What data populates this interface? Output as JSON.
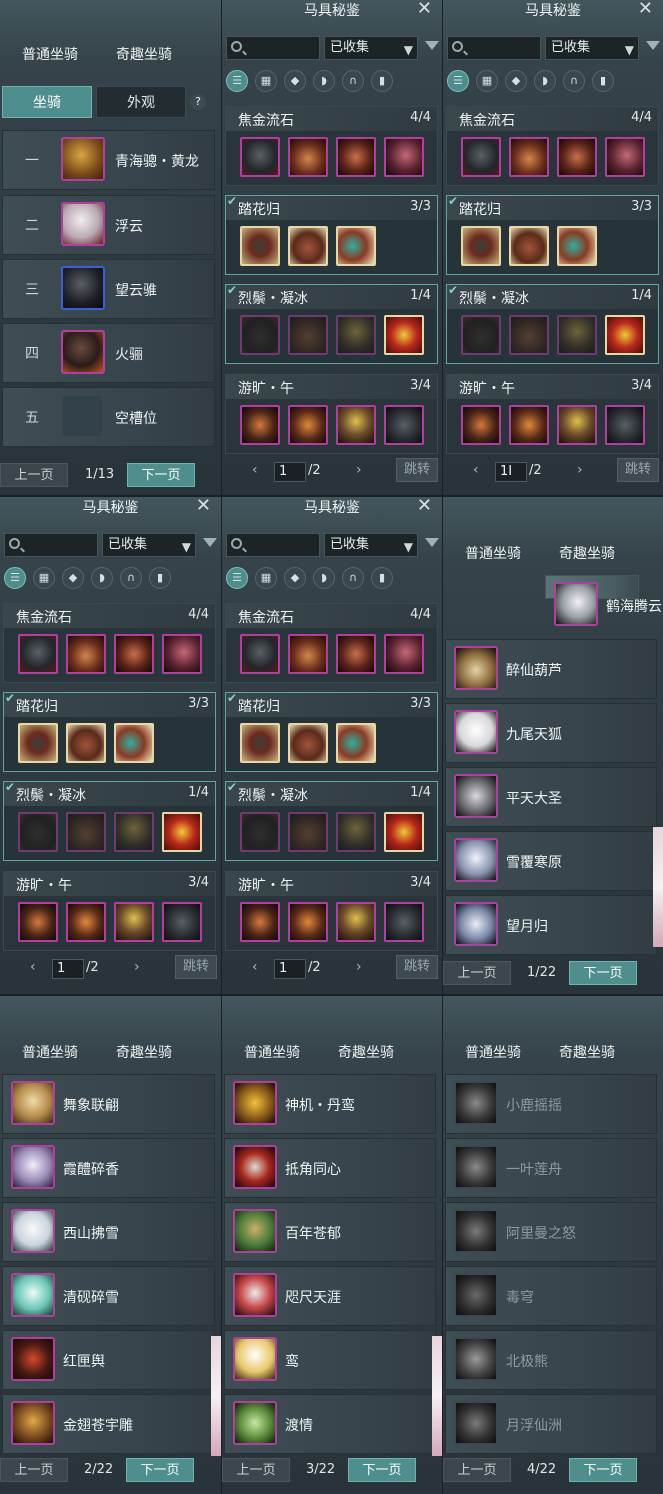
{
  "mount_tabs": {
    "normal": "普通坐骑",
    "fun": "奇趣坐骑"
  },
  "sub_tabs": {
    "mount": "坐骑",
    "appearance": "外观",
    "help": "?"
  },
  "pager": {
    "prev": "上一页",
    "next": "下一页"
  },
  "panel1": {
    "rows": [
      {
        "num": "一",
        "name": "青海骢・黄龙"
      },
      {
        "num": "二",
        "name": "浮云"
      },
      {
        "num": "三",
        "name": "望云骓"
      },
      {
        "num": "四",
        "name": "火骊"
      },
      {
        "num": "五",
        "name": "空槽位"
      }
    ],
    "page": "1/13"
  },
  "tack": {
    "title": "马具秘鉴",
    "close": "✕",
    "filter_value": "已收集",
    "page_input": "1",
    "page_input_cursor": "1I",
    "page_total": "/2",
    "jump": "跳转",
    "sets": [
      {
        "name": "焦金流石",
        "count": "4/4"
      },
      {
        "name": "踏花归",
        "count": "3/3"
      },
      {
        "name": "烈鬃・凝冰",
        "count": "1/4"
      },
      {
        "name": "游旷・午",
        "count": "3/4"
      }
    ],
    "arrows": {
      "left": "‹",
      "right": "›"
    }
  },
  "list_a": {
    "names": [
      "鹤海腾云",
      "醉仙葫芦",
      "九尾天狐",
      "平天大圣",
      "雪覆寒原",
      "望月归"
    ],
    "page": "1/22"
  },
  "list_b": {
    "names": [
      "舞象联翩",
      "霞醴碎香",
      "西山拂雪",
      "清砚碎雪",
      "红匣舆",
      "金翅苍宇雕"
    ],
    "page": "2/22"
  },
  "list_c": {
    "names": [
      "神机・丹鸾",
      "抵角同心",
      "百年苍郁",
      "咫尺天涯",
      "鸾",
      "渡情"
    ],
    "page": "3/22"
  },
  "list_d": {
    "names": [
      "小鹿摇摇",
      "一叶莲舟",
      "阿里曼之怒",
      "毒穹",
      "北极熊",
      "月浮仙洲"
    ],
    "page": "4/22"
  },
  "colors": {
    "accent": "#4e8f8d",
    "epic": "#b13fa0",
    "rare": "#3b5fd8"
  }
}
